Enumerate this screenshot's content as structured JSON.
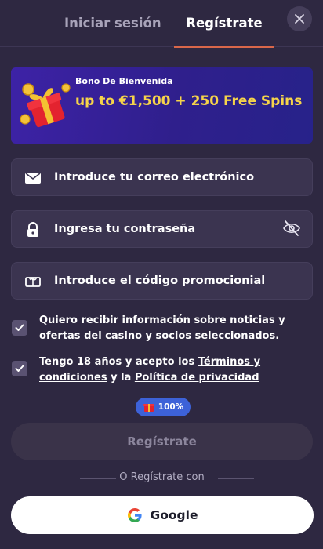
{
  "header": {
    "tab_login": "Iniciar sesión",
    "tab_register": "Regístrate"
  },
  "bonus": {
    "label": "Bono De Bienvenida",
    "offer": "up to €1,500 + 250 Free Spins"
  },
  "form": {
    "email_placeholder": "Introduce tu correo electrónico",
    "password_placeholder": "Ingresa tu contraseña",
    "promo_placeholder": "Introduce el código promocionial",
    "consent_marketing": "Quiero recibir información sobre noticias y ofertas del casino y socios seleccionados.",
    "consent_terms": {
      "prefix": "Tengo 18 años y acepto los ",
      "terms_link": "Términos y condiciones",
      "middle": " y la ",
      "privacy_link": "Política de privacidad"
    },
    "progress_badge": "100%",
    "progress": 1.0,
    "submit_label": "Regístrate"
  },
  "social": {
    "divider_text": "O Regístrate con",
    "google_label": "Google"
  },
  "icons": {
    "close": "close-icon",
    "gift": "gift-box-icon",
    "email": "envelope-icon",
    "password": "lock-icon",
    "visibility": "eye-off-icon",
    "promo": "ticket-icon",
    "check": "checkmark-icon",
    "google": "google-logo"
  },
  "colors": {
    "background": "#2e2841",
    "accent_underline": "#d9674a",
    "bonus_text": "#f6d44a",
    "badge": "#3d62d8"
  }
}
